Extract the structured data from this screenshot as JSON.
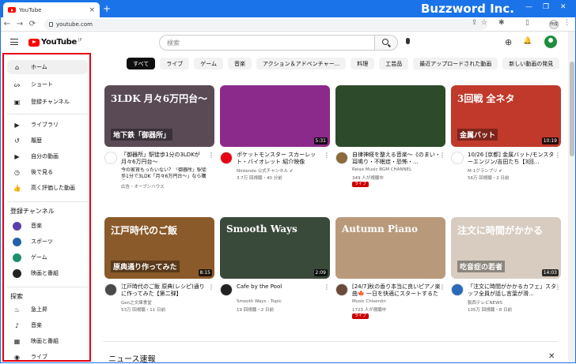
{
  "browser": {
    "tab_title": "YouTube",
    "tab_close": "×",
    "new_tab": "+",
    "url": "youtube.com",
    "brand": "Buzzword Inc.",
    "window_controls": [
      "—",
      "❐",
      "✕"
    ],
    "nav": [
      "←",
      "→",
      "⟳"
    ],
    "omni_icons": [
      "⇪",
      "☆"
    ],
    "toolbar_icons": [
      "✱",
      "▯"
    ],
    "profile_chip": "作成",
    "menu": "⋮"
  },
  "header": {
    "logo_text": "YouTube",
    "logo_region": "JP",
    "search_placeholder": "検索",
    "create_icon": "⊕",
    "bell_icon": "🔔"
  },
  "sidebar": {
    "main": [
      {
        "label": "ホーム",
        "icon": "home-icon",
        "glyph": "⌂"
      },
      {
        "label": "ショート",
        "icon": "shorts-icon",
        "glyph": "ᔕ"
      },
      {
        "label": "登録チャンネル",
        "icon": "subscriptions-icon",
        "glyph": "▣"
      }
    ],
    "library": [
      {
        "label": "ライブラリ",
        "icon": "library-icon",
        "glyph": "▶"
      },
      {
        "label": "履歴",
        "icon": "history-icon",
        "glyph": "↺"
      },
      {
        "label": "自分の動画",
        "icon": "your-videos-icon",
        "glyph": "▶"
      },
      {
        "label": "後で見る",
        "icon": "watch-later-icon",
        "glyph": "◷"
      },
      {
        "label": "高く評価した動画",
        "icon": "liked-videos-icon",
        "glyph": "👍"
      }
    ],
    "subs_title": "登録チャンネル",
    "subs": [
      {
        "label": "音楽",
        "color": "#5b3fa8"
      },
      {
        "label": "スポーツ",
        "color": "#2460a8"
      },
      {
        "label": "ゲーム",
        "color": "#1e8e6e"
      },
      {
        "label": "映画と番組",
        "color": "#222222"
      }
    ],
    "explore_title": "探索",
    "explore": [
      {
        "label": "急上昇",
        "icon": "trending-icon",
        "glyph": "♨"
      },
      {
        "label": "音楽",
        "icon": "music-icon",
        "glyph": "♪"
      },
      {
        "label": "映画と番組",
        "icon": "movies-icon",
        "glyph": "▦"
      },
      {
        "label": "ライブ",
        "icon": "live-icon",
        "glyph": "◉"
      }
    ]
  },
  "chips": [
    "すべて",
    "ライブ",
    "ゲーム",
    "音楽",
    "アクション＆アドベンチャー...",
    "料理",
    "工芸品",
    "最近アップロードされた動画",
    "新しい動画の発見"
  ],
  "videos": [
    {
      "title": "「御器所」駅徒歩1分の3LDKが月々6万円台～",
      "line2": "今の家賃もったいない？「御器所」駅徒歩1分で3LDK「月々6万円台～」なら購賃より...",
      "channel": "広告・オープンハウス",
      "stats": "",
      "duration": "",
      "live": "",
      "thumb_text": "3LDK 月々6万円台～",
      "thumb_sub": "地下鉄「御器所」",
      "thumb_bg": "#5a4a56",
      "av_color": "#ffffff"
    },
    {
      "title": "ポケットモンスター スカーレット・バイオレット 紹介映像",
      "line2": "",
      "channel": "Nintendo 公式チャンネル ✔",
      "stats": "3.7万 回視聴・40 分前",
      "duration": "5:31",
      "live": "",
      "thumb_text": "",
      "thumb_sub": "",
      "thumb_bg": "#8b2a8a",
      "av_color": "#e60012"
    },
    {
      "title": "自律神経を整える音楽～《のまい・耳鳴り・不眠症・恐怖・...",
      "line2": "",
      "channel": "Relax Music BGM CHANNEL",
      "stats": "349 人が視聴中",
      "duration": "",
      "live": "ライブ",
      "thumb_text": "",
      "thumb_sub": "",
      "thumb_bg": "#2d4a2a",
      "av_color": "#8a6a3a"
    },
    {
      "title": "10/26 [京都] 金属バット/モンスターエンジン/吉田たち【3回...",
      "line2": "",
      "channel": "M-1グランプリ ✔",
      "stats": "56万 回視聴・2 日前",
      "duration": "10:19",
      "live": "",
      "thumb_text": "3回戦 全ネタ",
      "thumb_sub": "金属バット",
      "thumb_bg": "#c0392b",
      "av_color": "#ffffff"
    },
    {
      "title": "江戸時代のご飯 原典(レシピ)通りに作ってみた【第二弾】",
      "line2": "",
      "channel": "Gen之文庫食堂",
      "stats": "53万 回視聴・11 日前",
      "duration": "8:15",
      "live": "",
      "thumb_text": "江戸時代のご飯",
      "thumb_sub": "原典通り作ってみた",
      "thumb_bg": "#8a5a2a",
      "av_color": "#4a4a4a"
    },
    {
      "title": "Cafe by the Pool",
      "line2": "",
      "channel": "Smooth Ways - Topic",
      "stats": "19 回視聴・2 日前",
      "duration": "2:09",
      "live": "",
      "thumb_text": "Smooth Ways",
      "thumb_sub": "",
      "thumb_bg": "#3a4a3a",
      "av_color": "#222222"
    },
    {
      "title": "[24/7]秋の香り本当に良いピアノ楽曲🍁 一日を快適にスタートするためのデイリ...",
      "line2": "",
      "channel": "Music Chisenōn",
      "stats": "1723 人が視聴中",
      "duration": "",
      "live": "ライブ",
      "thumb_text": "Autumn Piano",
      "thumb_sub": "",
      "thumb_bg": "#b89a7a",
      "av_color": "#6a4a3a"
    },
    {
      "title": "「注文に時間がかかるカフェ」スタッフ全員が話し言葉が滑...",
      "line2": "",
      "channel": "製西テレビNEWS",
      "stats": "105万 回視聴・8 日前",
      "duration": "14:03",
      "live": "",
      "thumb_text": "注文に時間がかかる",
      "thumb_sub": "吃音症の若者",
      "thumb_bg": "#d8ccc0",
      "av_color": "#2a6ab8"
    }
  ],
  "news_title": "ニュース速報",
  "news_close": "✕"
}
